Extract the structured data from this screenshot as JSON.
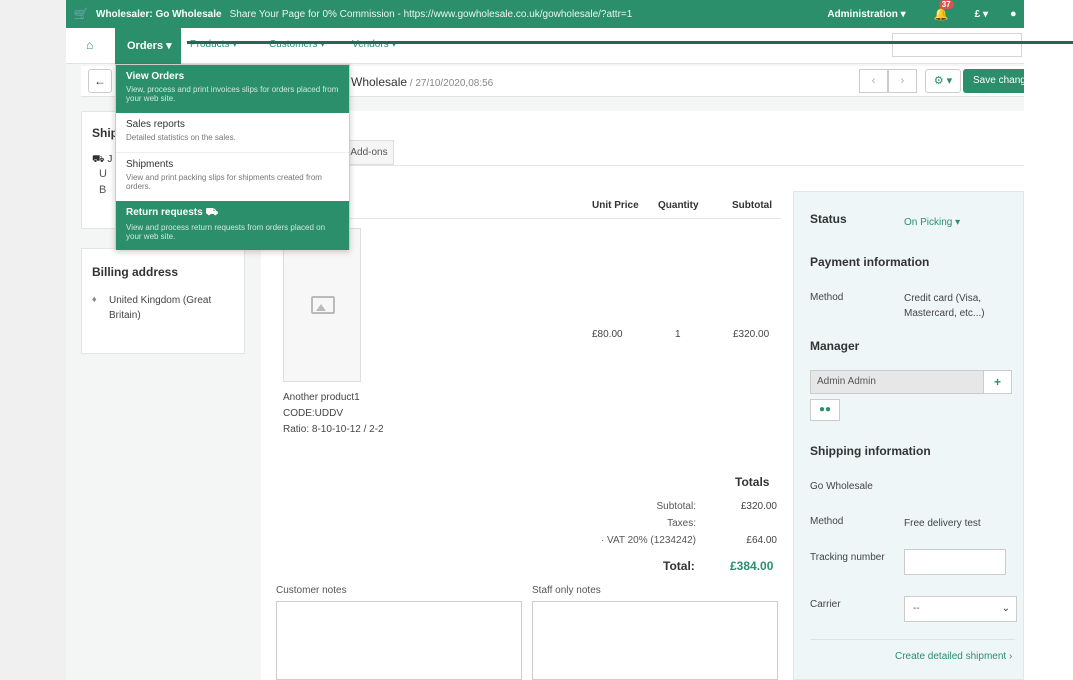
{
  "topbar": {
    "cart_icon": "cart-icon",
    "store_name": "Wholesaler: Go Wholesale",
    "share_text": "Share Your Page for 0% Commission - https://www.gowholesale.co.uk/gowholesale/?attr=1",
    "admin_menu": "Administration ▾",
    "notifications_count": "37",
    "currency": "£ ▾",
    "user_icon": "user-icon"
  },
  "nav": {
    "home_icon": "home-icon",
    "orders": "Orders ▾",
    "products": "Products ▾",
    "customers": "Customers ▾",
    "vendors": "Vendors ▾"
  },
  "toolbar": {
    "title": "Wholesale",
    "date": " / 27/10/2020,08:56",
    "save_label": "Save changes",
    "prev": "‹",
    "next": "›",
    "gear": "⚙ ▾"
  },
  "dropdown": {
    "items": [
      {
        "label": "View Orders",
        "desc": "View, process and print invoices slips for orders placed from your web site."
      },
      {
        "label": "Sales reports",
        "desc": "Detailed statistics on the sales."
      },
      {
        "label": "Shipments",
        "desc": "View and print packing slips for shipments created from orders."
      },
      {
        "label": "Return requests ⛟",
        "desc": "View and process return requests from orders placed on your web site."
      }
    ]
  },
  "shipping_card": {
    "title": "Ship",
    "line1": "J",
    "line2": "U",
    "line3": "B"
  },
  "billing_card": {
    "title": "Billing address",
    "value": "United Kingdom (Great Britain)"
  },
  "tabs": {
    "addons": "Add-ons"
  },
  "items_table": {
    "headers": {
      "unit_price": "Unit Price",
      "quantity": "Quantity",
      "subtotal": "Subtotal"
    },
    "rows": [
      {
        "name": "Another product1",
        "code": "CODE:UDDV",
        "ratio": "Ratio: 8-10-10-12 / 2-2",
        "unit_price": "£80.00",
        "quantity": "1",
        "subtotal": "£320.00"
      }
    ]
  },
  "totals": {
    "title": "Totals",
    "subtotal_label": "Subtotal:",
    "subtotal_value": "£320.00",
    "taxes_label": "Taxes:",
    "vat_label": "· VAT 20% (1234242)",
    "vat_value": "£64.00",
    "total_label": "Total:",
    "total_value": "£384.00"
  },
  "notes": {
    "customer_label": "Customer notes",
    "staff_label": "Staff only notes"
  },
  "side": {
    "status_label": "Status",
    "status_value": "On Picking ▾",
    "payment_title": "Payment information",
    "method_label": "Method",
    "method_value": "Credit card (Visa, Mastercard, etc...)",
    "manager_title": "Manager",
    "manager_value": "Admin Admin",
    "shipping_title": "Shipping information",
    "shipping_company": "Go Wholesale",
    "ship_method_label": "Method",
    "ship_method_value": "Free delivery test",
    "tracking_label": "Tracking number",
    "tracking_value": "",
    "carrier_label": "Carrier",
    "carrier_value": "--",
    "create_link": "Create detailed shipment ›"
  }
}
